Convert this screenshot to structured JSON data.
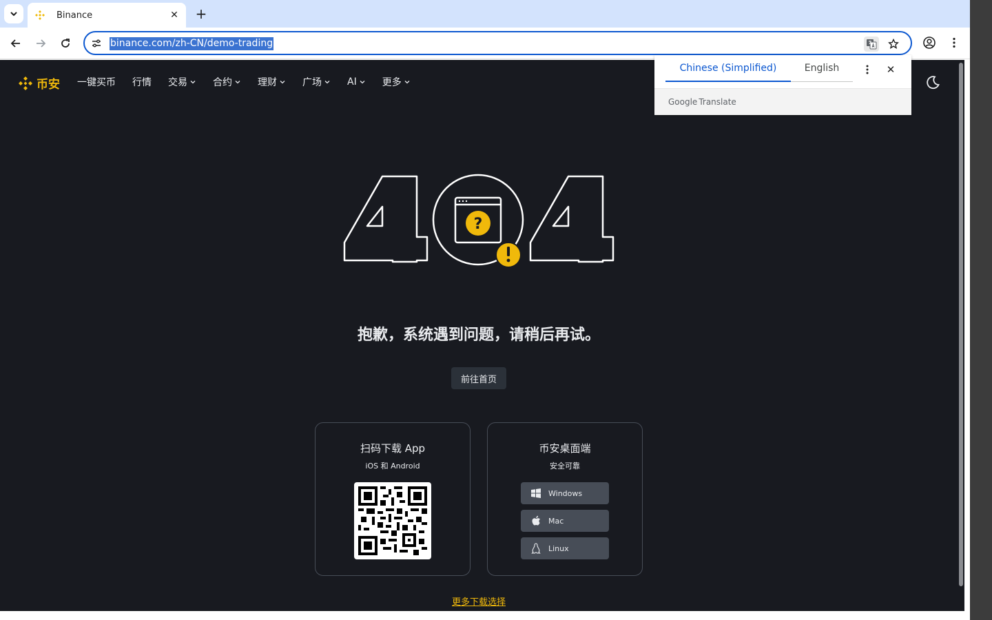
{
  "browser": {
    "tab_title": "Binance",
    "url": "binance.com/zh-CN/demo-trading"
  },
  "header": {
    "logo_text": "币安",
    "nav": [
      {
        "label": "一键买币",
        "has_menu": false
      },
      {
        "label": "行情",
        "has_menu": false
      },
      {
        "label": "交易",
        "has_menu": true
      },
      {
        "label": "合约",
        "has_menu": true
      },
      {
        "label": "理财",
        "has_menu": true
      },
      {
        "label": "广场",
        "has_menu": true
      },
      {
        "label": "AI",
        "has_menu": true
      },
      {
        "label": "更多",
        "has_menu": true
      }
    ]
  },
  "translate": {
    "source_lang": "Chinese (Simplified)",
    "target_lang": "English",
    "brand_google": "Google",
    "brand_translate": "Translate"
  },
  "error": {
    "code": "404",
    "message": "抱歉，系统遇到问题，请稍后再试。",
    "home_button": "前往首页"
  },
  "downloads": {
    "app_title": "扫码下载 App",
    "app_sub": "iOS 和 Android",
    "desktop_title": "币安桌面端",
    "desktop_sub": "安全可靠",
    "buttons": [
      {
        "label": "Windows",
        "icon": "windows-icon"
      },
      {
        "label": "Mac",
        "icon": "apple-icon"
      },
      {
        "label": "Linux",
        "icon": "linux-icon"
      }
    ],
    "more_link": "更多下载选择"
  },
  "colors": {
    "brand": "#f0b90b",
    "background": "#181a20",
    "button": "#2b3139",
    "chrome_accent": "#0b57d0"
  }
}
